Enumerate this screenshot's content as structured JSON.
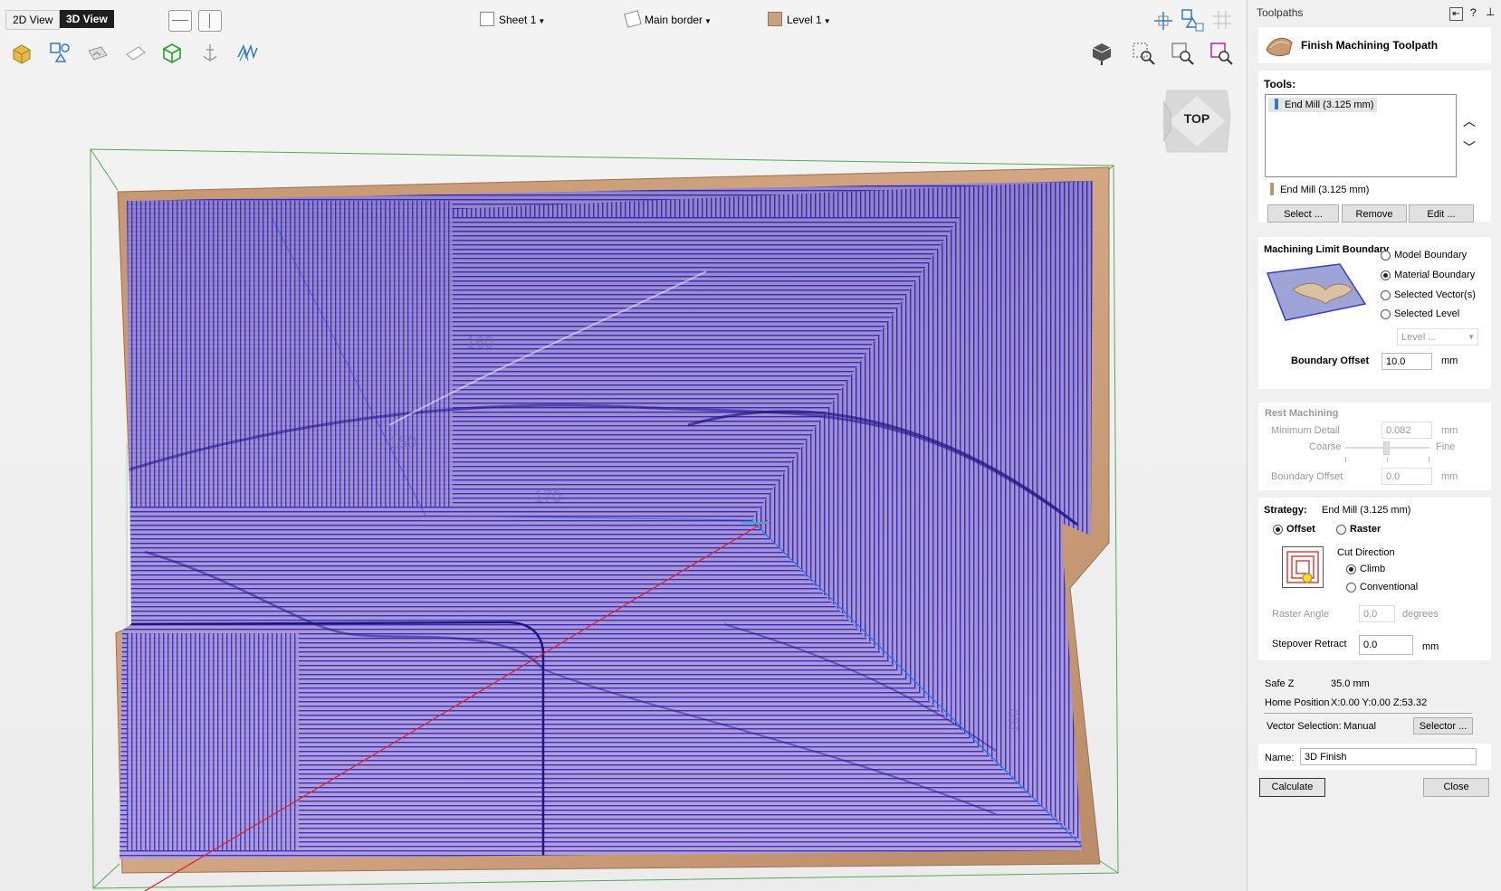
{
  "viewbar": {
    "view_2d": "2D View",
    "view_3d": "3D View",
    "sheet": "Sheet 1",
    "border": "Main border",
    "level": "Level 1",
    "cube_label": "TOP"
  },
  "model_labels": [
    "160",
    "150",
    "170",
    "160"
  ],
  "panel": {
    "header_title": "Toolpaths",
    "help": "?",
    "title": "Finish Machining Toolpath",
    "tools": {
      "label": "Tools:",
      "list": [
        "End Mill (3.125 mm)"
      ],
      "current": "End Mill (3.125 mm)",
      "select": "Select ...",
      "remove": "Remove",
      "edit": "Edit ..."
    },
    "boundary": {
      "title": "Machining Limit Boundary",
      "options": [
        "Model Boundary",
        "Material Boundary",
        "Selected Vector(s)",
        "Selected Level"
      ],
      "selected": "Material Boundary",
      "level_placeholder": "Level ...",
      "offset_label": "Boundary Offset",
      "offset_value": "10.0",
      "unit": "mm"
    },
    "rest": {
      "title": "Rest Machining",
      "min_detail_label": "Minimum Detail",
      "min_detail_value": "0.082",
      "unit": "mm",
      "coarse": "Coarse",
      "fine": "Fine",
      "slider_value": 0.48,
      "offset_label": "Boundary Offset",
      "offset_value": "0.0"
    },
    "strategy": {
      "label": "Strategy:",
      "tool": "End Mill (3.125 mm)",
      "offset": "Offset",
      "raster": "Raster",
      "cut_direction": "Cut Direction",
      "climb": "Climb",
      "conventional": "Conventional",
      "raster_angle_label": "Raster Angle",
      "raster_angle_value": "0.0",
      "raster_angle_unit": "degrees",
      "stepover_label": "Stepover Retract",
      "stepover_value": "0.0",
      "unit": "mm"
    },
    "info": {
      "safe_z_label": "Safe Z",
      "safe_z_value": "35.0 mm",
      "home_label": "Home Position",
      "home_value": "X:0.00 Y:0.00 Z:53.32"
    },
    "vector_selection": {
      "label": "Vector Selection:",
      "value": "Manual",
      "button": "Selector ..."
    },
    "name": {
      "label": "Name:",
      "value": "3D Finish"
    },
    "calculate": "Calculate",
    "close": "Close"
  },
  "colors": {
    "toolpath": "#3a2fc8",
    "material": "#c99b78",
    "accent_red": "#c41e2a"
  }
}
